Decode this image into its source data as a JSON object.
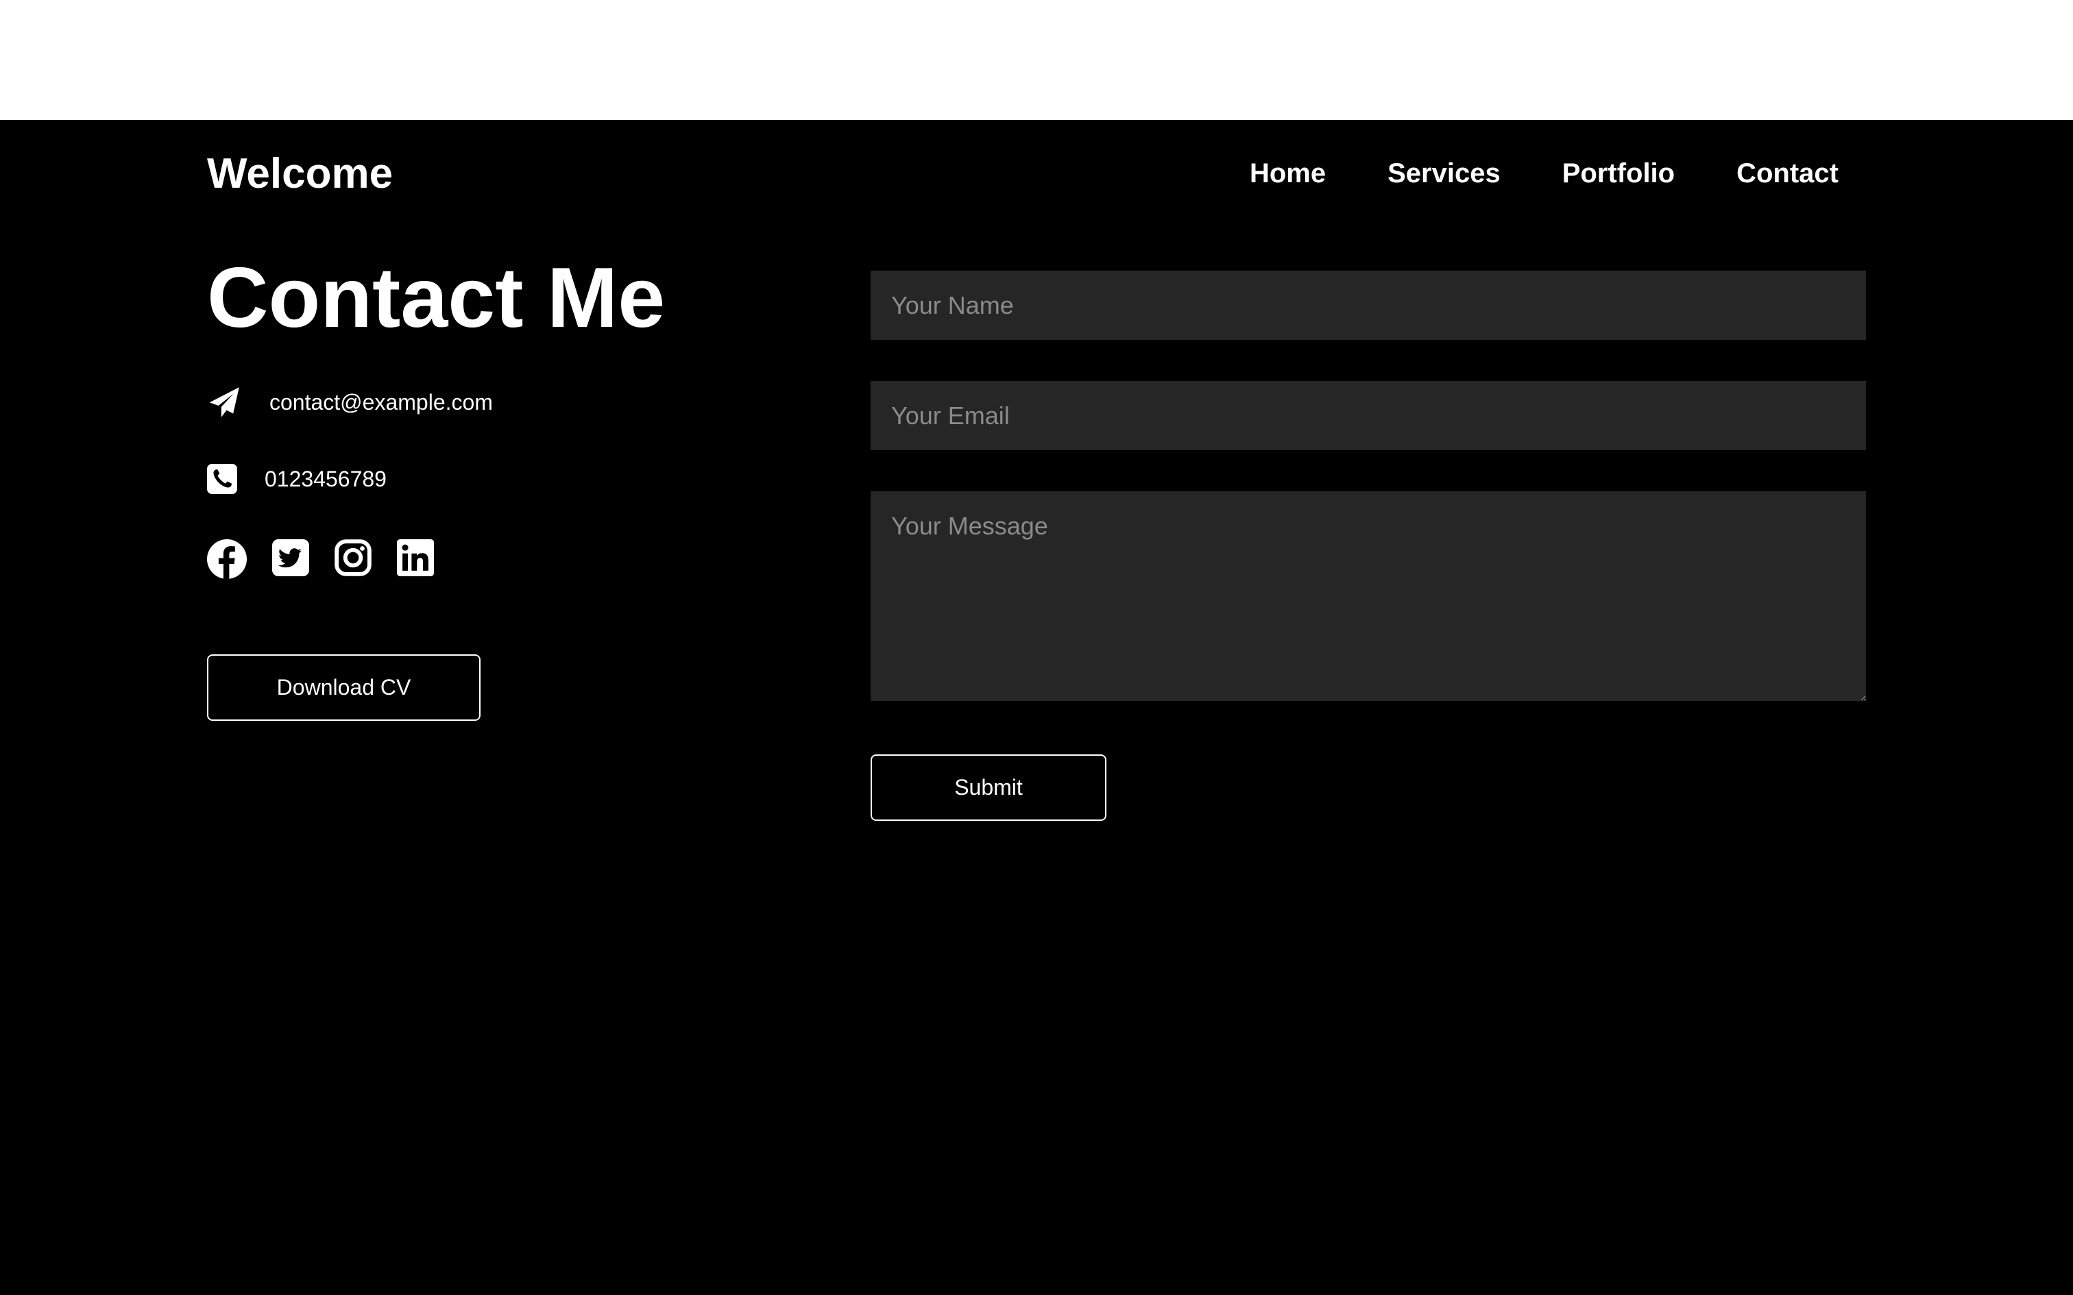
{
  "header": {
    "brand": "Welcome",
    "nav": [
      "Home",
      "Services",
      "Portfolio",
      "Contact"
    ]
  },
  "contact": {
    "title": "Contact Me",
    "email": "contact@example.com",
    "phone": "0123456789",
    "email_icon": "paper-plane-icon",
    "phone_icon": "phone-icon",
    "socials": [
      "facebook-icon",
      "twitter-icon",
      "instagram-icon",
      "linkedin-icon"
    ],
    "download_label": "Download CV"
  },
  "form": {
    "name_placeholder": "Your Name",
    "email_placeholder": "Your Email",
    "message_placeholder": "Your Message",
    "submit_label": "Submit"
  },
  "colors": {
    "background": "#000000",
    "field_background": "#262626",
    "text": "#ffffff",
    "placeholder": "#8a8a8a"
  }
}
